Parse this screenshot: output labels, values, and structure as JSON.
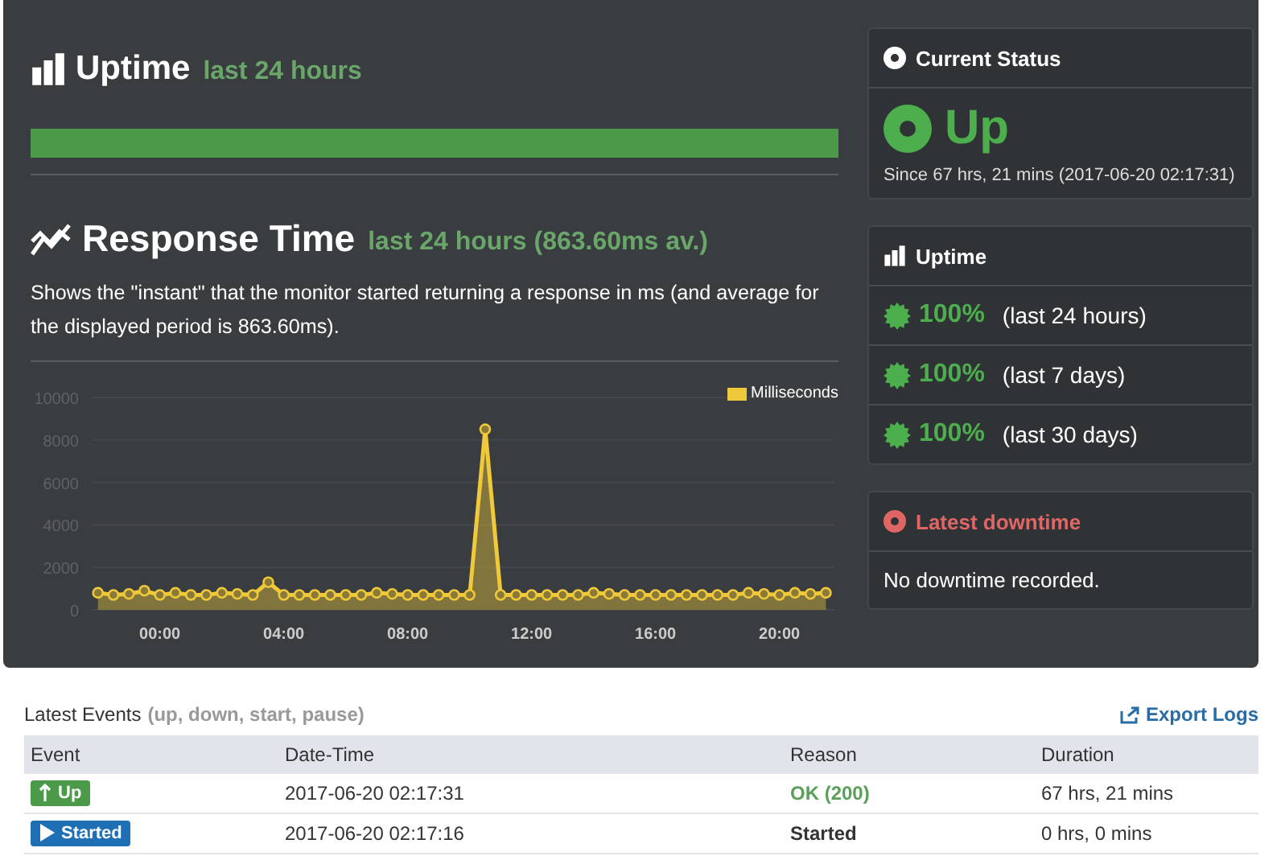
{
  "uptime_section": {
    "title": "Uptime",
    "period": "last 24 hours",
    "level": 1
  },
  "response_section": {
    "title": "Response Time",
    "period": "last 24 hours (863.60ms av.)",
    "description": "Shows the \"instant\" that the monitor started returning a response in ms (and average for the displayed period is 863.60ms).",
    "chart_data": {
      "type": "area",
      "grid": true,
      "xlim": [
        -2.2,
        21.8
      ],
      "x": [
        -2,
        -1.5,
        -1,
        -0.5,
        0,
        0.5,
        1,
        1.5,
        2,
        2.5,
        3,
        3.5,
        4,
        4.5,
        5,
        5.5,
        6,
        6.5,
        7,
        7.5,
        8,
        8.5,
        9,
        9.5,
        10,
        10.5,
        11,
        11.5,
        12,
        12.5,
        13,
        13.5,
        14,
        14.5,
        15,
        15.5,
        16,
        16.5,
        17,
        17.5,
        18,
        18.5,
        19,
        19.5,
        20,
        20.5,
        21,
        21.5
      ],
      "xticks": [
        {
          "value": 0,
          "label": "00:00"
        },
        {
          "value": 4,
          "label": "04:00"
        },
        {
          "value": 8,
          "label": "08:00"
        },
        {
          "value": 12,
          "label": "12:00"
        },
        {
          "value": 16,
          "label": "16:00"
        },
        {
          "value": 20,
          "label": "20:00"
        }
      ],
      "ylim": [
        0,
        10000
      ],
      "yticks": [
        0,
        2000,
        4000,
        6000,
        8000,
        10000
      ],
      "series": [
        {
          "name": "Milliseconds",
          "color": "#f0c93a",
          "values": [
            800,
            700,
            750,
            900,
            700,
            800,
            700,
            700,
            800,
            750,
            700,
            1300,
            700,
            700,
            700,
            700,
            700,
            700,
            800,
            750,
            700,
            700,
            700,
            700,
            700,
            8500,
            700,
            700,
            700,
            700,
            700,
            700,
            800,
            750,
            700,
            700,
            700,
            700,
            700,
            700,
            700,
            700,
            800,
            750,
            700,
            800,
            750,
            800
          ]
        }
      ]
    }
  },
  "current_status": {
    "title": "Current Status",
    "status": "Up",
    "since": "Since 67 hrs, 21 mins (2017-06-20 02:17:31)"
  },
  "uptime_panel": {
    "title": "Uptime",
    "rows": [
      {
        "value": "100%",
        "period": "(last 24 hours)"
      },
      {
        "value": "100%",
        "period": "(last 7 days)"
      },
      {
        "value": "100%",
        "period": "(last 30 days)"
      }
    ]
  },
  "latest_downtime": {
    "title": "Latest downtime",
    "message": "No downtime recorded."
  },
  "events": {
    "title": "Latest Events",
    "filter": "(up, down, start, pause)",
    "export": "Export Logs",
    "columns": [
      "Event",
      "Date-Time",
      "Reason",
      "Duration"
    ],
    "rows": [
      {
        "event": "Up",
        "kind": "up",
        "datetime": "2017-06-20 02:17:31",
        "reason": {
          "text": "OK (200)",
          "kind": "ok"
        },
        "duration": "67 hrs, 21 mins"
      },
      {
        "event": "Started",
        "kind": "started",
        "datetime": "2017-06-20 02:17:16",
        "reason": {
          "text": "Started",
          "kind": "plain"
        },
        "duration": "0 hrs, 0 mins"
      }
    ]
  }
}
